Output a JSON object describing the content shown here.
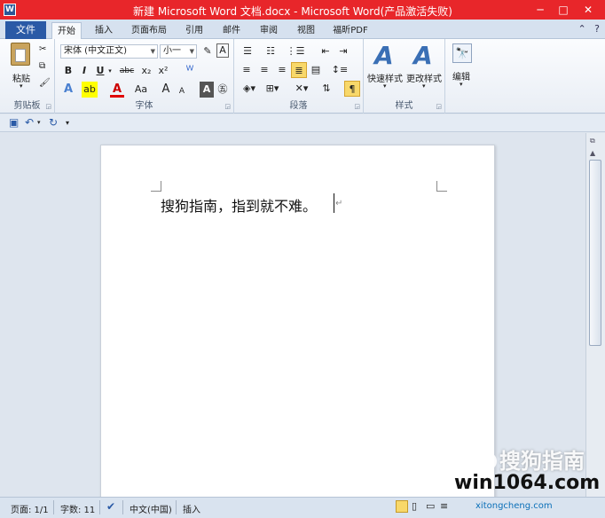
{
  "window": {
    "title": "新建 Microsoft Word 文档.docx - Microsoft Word(产品激活失败)",
    "app_icon": "W",
    "controls": [
      "─",
      "□",
      "✕"
    ]
  },
  "tabs": {
    "file": "文件",
    "items": [
      "开始",
      "插入",
      "页面布局",
      "引用",
      "邮件",
      "审阅",
      "视图",
      "福昕PDF"
    ],
    "active_index": 0
  },
  "ribbon": {
    "clipboard": {
      "paste_label": "粘贴",
      "group_label": "剪贴板"
    },
    "font": {
      "font_name": "宋体 (中文正文)",
      "font_size": "小一",
      "group_label": "字体",
      "bold": "B",
      "italic": "I",
      "underline": "U",
      "strikethrough": "abc",
      "subscript": "x₂",
      "superscript": "x²",
      "font_color": "A",
      "change_case": "Aa",
      "grow": "A",
      "shrink": "A",
      "char_border": "A",
      "phonetic": "wén"
    },
    "paragraph": {
      "group_label": "段落",
      "highlighted_button": "¶"
    },
    "styles": {
      "quick_styles_label": "快速样式",
      "change_styles_label": "更改样式",
      "group_label": "样式"
    },
    "editing": {
      "label": "编辑"
    }
  },
  "document": {
    "text": "搜狗指南，指到就不难。"
  },
  "statusbar": {
    "page": "页面: 1/1",
    "words": "字数: 11",
    "language": "中文(中国)",
    "mode": "插入"
  },
  "watermark": {
    "line1": "搜狗指南",
    "line2": "win1064.com",
    "line3": "xitongcheng.com"
  }
}
